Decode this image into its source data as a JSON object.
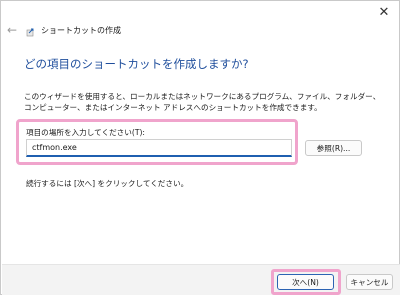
{
  "window": {
    "close_label": "✕",
    "back_label": "←"
  },
  "header": {
    "title": "ショートカットの作成"
  },
  "main": {
    "heading": "どの項目のショートカットを作成しますか?",
    "description": "このウィザードを使用すると、ローカルまたはネットワークにあるプログラム、ファイル、フォルダー、コンピューター、またはインターネット アドレスへのショートカットを作成できます。",
    "location_label": "項目の場所を入力してください(T):",
    "location_value": "ctfmon.exe",
    "browse_label": "参照(R)...",
    "continue_text": "続行するには [次へ] をクリックしてください。"
  },
  "footer": {
    "next_label": "次へ(N)",
    "cancel_label": "キャンセル"
  },
  "colors": {
    "accent": "#1f4e9c",
    "highlight": "#f0a4cc",
    "focus_border": "#1f5fb0"
  },
  "icons": {
    "close": "close-icon",
    "back": "back-arrow-icon",
    "wizard": "shortcut-wizard-icon"
  }
}
